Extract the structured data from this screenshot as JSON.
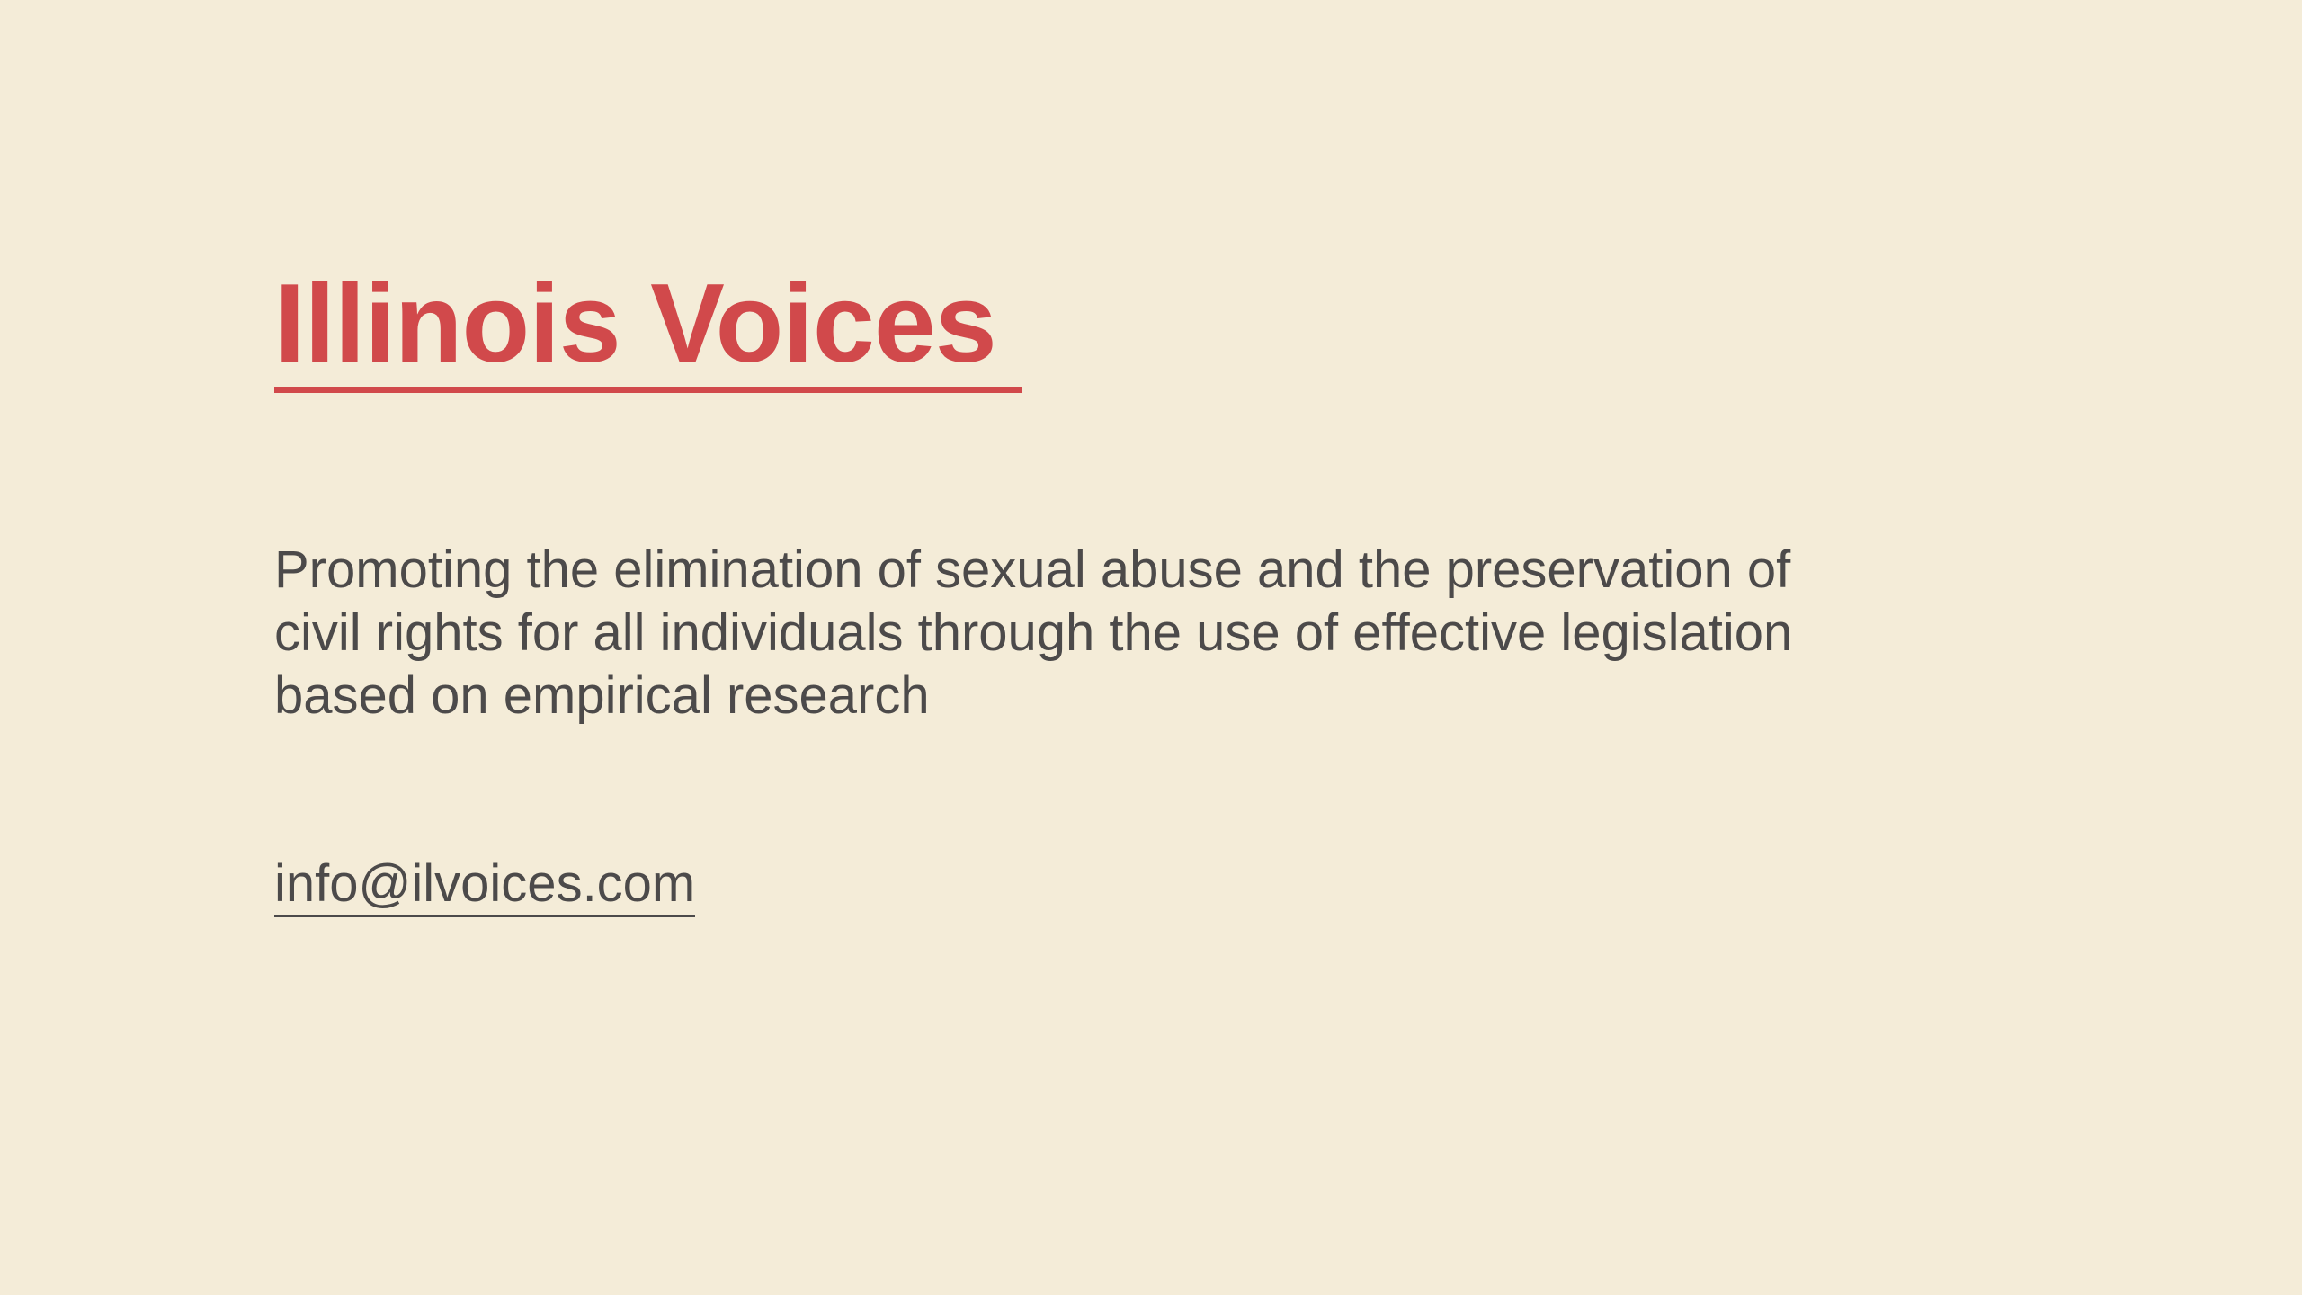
{
  "site": {
    "title": "Illinois Voices",
    "tagline": "Promoting the elimination of sexual abuse and the preservation of civil rights for all individuals through the use of effective legislation based on empirical research",
    "email": "info@ilvoices.com"
  },
  "colors": {
    "background": "#f4ecd8",
    "title": "#d1494b",
    "text": "#4c4a4a"
  }
}
